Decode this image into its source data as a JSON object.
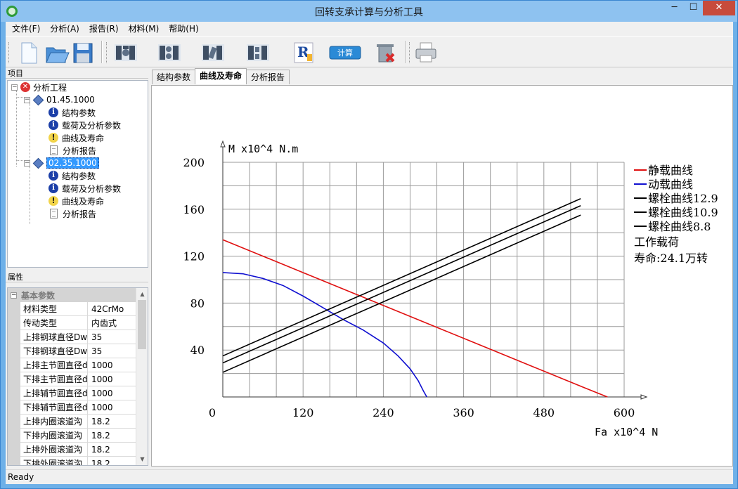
{
  "window": {
    "title": "回转支承计算与分析工具",
    "minimize_glyph": "─",
    "maximize_glyph": "☐",
    "close_glyph": "✕"
  },
  "menu": [
    "文件(F)",
    "分析(A)",
    "报告(R)",
    "材料(M)",
    "帮助(H)"
  ],
  "toolbar": {
    "buttons": [
      {
        "icon": "new-file-icon"
      },
      {
        "icon": "open-folder-icon"
      },
      {
        "icon": "save-icon"
      },
      {
        "icon": "bearing-type-1-icon"
      },
      {
        "icon": "bearing-type-2-icon"
      },
      {
        "icon": "bearing-type-3-icon"
      },
      {
        "icon": "bearing-type-4-icon"
      },
      {
        "icon": "report-icon",
        "badge": "R"
      },
      {
        "icon": "calculate-button",
        "label": "计算"
      },
      {
        "icon": "delete-icon"
      },
      {
        "icon": "print-icon"
      }
    ]
  },
  "tree": {
    "header": "项目",
    "root": "分析工程",
    "projects": [
      {
        "name": "01.45.1000",
        "children": [
          "结构参数",
          "载荷及分析参数",
          "曲线及寿命",
          "分析报告"
        ],
        "selected": false
      },
      {
        "name": "02.35.1000",
        "children": [
          "结构参数",
          "载荷及分析参数",
          "曲线及寿命",
          "分析报告"
        ],
        "selected": true
      }
    ]
  },
  "properties": {
    "header": "属性",
    "category": "基本参数",
    "rows": [
      {
        "name": "材料类型",
        "value": "42CrMo"
      },
      {
        "name": "传动类型",
        "value": "内齿式"
      },
      {
        "name": "上排钢球直径Dw",
        "value": "35"
      },
      {
        "name": "下排钢球直径Dw",
        "value": "35"
      },
      {
        "name": "上排主节圆直径d",
        "value": "1000"
      },
      {
        "name": "下排主节圆直径d",
        "value": "1000"
      },
      {
        "name": "上排辅节圆直径d",
        "value": "1000"
      },
      {
        "name": "下排辅节圆直径d",
        "value": "1000"
      },
      {
        "name": "上排内圈滚道沟",
        "value": "18.2"
      },
      {
        "name": "下排内圈滚道沟",
        "value": "18.2"
      },
      {
        "name": "上排外圈滚道沟",
        "value": "18.2"
      },
      {
        "name": "下排外圈滚道沟",
        "value": "18.2"
      }
    ]
  },
  "tabs": [
    "结构参数",
    "曲线及寿命",
    "分析报告"
  ],
  "active_tab": 1,
  "status": "Ready",
  "chart_data": {
    "type": "line",
    "xlabel": "Fa x10^4 N",
    "ylabel": "M x10^4 N.m",
    "xlim": [
      0,
      600
    ],
    "ylim": [
      0,
      200
    ],
    "x_ticks": [
      0,
      120,
      240,
      360,
      480,
      600
    ],
    "y_ticks": [
      40,
      80,
      120,
      160,
      200
    ],
    "grid": true,
    "legend_position": "top-right",
    "series": [
      {
        "name": "静载曲线",
        "color": "#e01010",
        "x": [
          0,
          60,
          120,
          180,
          240,
          300,
          360,
          420,
          480,
          540,
          575
        ],
        "y": [
          134,
          120,
          106,
          92,
          78,
          64,
          50,
          36,
          22,
          8,
          0
        ]
      },
      {
        "name": "动载曲线",
        "color": "#1010d0",
        "x": [
          0,
          30,
          60,
          90,
          120,
          150,
          180,
          210,
          240,
          262,
          280,
          292,
          300,
          305
        ],
        "y": [
          106,
          105,
          101,
          95,
          86,
          76,
          66,
          57,
          46,
          35,
          24,
          14,
          5,
          0
        ]
      },
      {
        "name": "螺栓曲线12.9",
        "color": "#000000",
        "x": [
          0,
          535
        ],
        "y": [
          35,
          169
        ]
      },
      {
        "name": "螺栓曲线10.9",
        "color": "#000000",
        "x": [
          0,
          535
        ],
        "y": [
          29,
          163
        ]
      },
      {
        "name": "螺栓曲线8.8",
        "color": "#000000",
        "x": [
          0,
          535
        ],
        "y": [
          21,
          155
        ]
      }
    ],
    "annotations": [
      "工作载荷",
      "寿命:24.1万转"
    ]
  }
}
